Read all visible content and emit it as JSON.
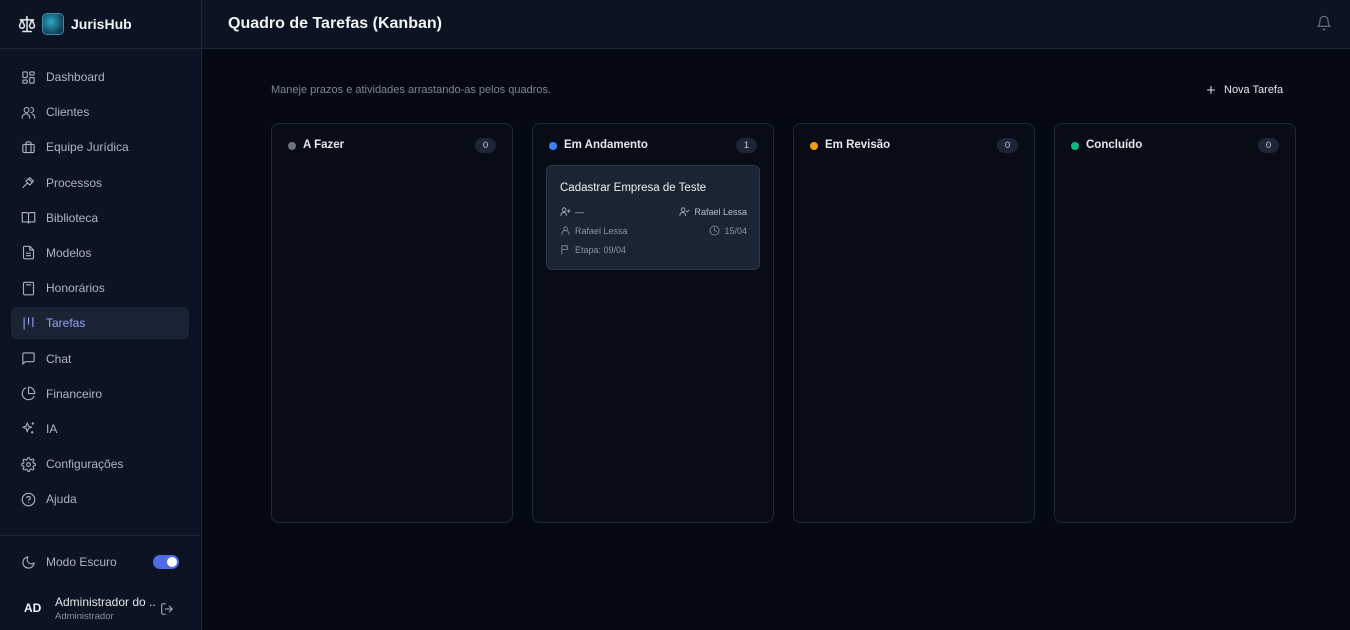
{
  "brand": {
    "name": "JurisHub"
  },
  "nav": [
    {
      "label": "Dashboard",
      "icon": "dashboard-icon"
    },
    {
      "label": "Clientes",
      "icon": "users-icon"
    },
    {
      "label": "Equipe Jurídica",
      "icon": "briefcase-icon"
    },
    {
      "label": "Processos",
      "icon": "gavel-icon"
    },
    {
      "label": "Biblioteca",
      "icon": "book-icon"
    },
    {
      "label": "Modelos",
      "icon": "file-icon"
    },
    {
      "label": "Honorários",
      "icon": "calculator-icon"
    },
    {
      "label": "Tarefas",
      "icon": "kanban-icon",
      "active": true
    },
    {
      "label": "Chat",
      "icon": "chat-icon"
    },
    {
      "label": "Financeiro",
      "icon": "pie-chart-icon"
    },
    {
      "label": "IA",
      "icon": "sparkles-icon"
    },
    {
      "label": "Configurações",
      "icon": "gear-icon"
    },
    {
      "label": "Ajuda",
      "icon": "help-icon"
    }
  ],
  "dark_mode": {
    "label": "Modo Escuro",
    "enabled": true
  },
  "user": {
    "initials": "AD",
    "name": "Administrador do ...",
    "role": "Administrador"
  },
  "header": {
    "title": "Quadro de Tarefas (Kanban)"
  },
  "main": {
    "subtitle": "Maneje prazos e atividades arrastando-as pelos quadros.",
    "new_task_label": "Nova Tarefa"
  },
  "columns": [
    {
      "title": "A Fazer",
      "count": "0",
      "color": "#6b7280"
    },
    {
      "title": "Em Andamento",
      "count": "1",
      "color": "#3b82f6"
    },
    {
      "title": "Em Revisão",
      "count": "0",
      "color": "#f59e0b"
    },
    {
      "title": "Concluído",
      "count": "0",
      "color": "#10b981"
    }
  ],
  "cards": {
    "in_progress": [
      {
        "title": "Cadastrar Empresa de Teste",
        "client": "—",
        "assignee": "Rafael Lessa",
        "creator": "Rafael Lessa",
        "due": "15/04",
        "stage": "Etapa: 09/04"
      }
    ]
  }
}
